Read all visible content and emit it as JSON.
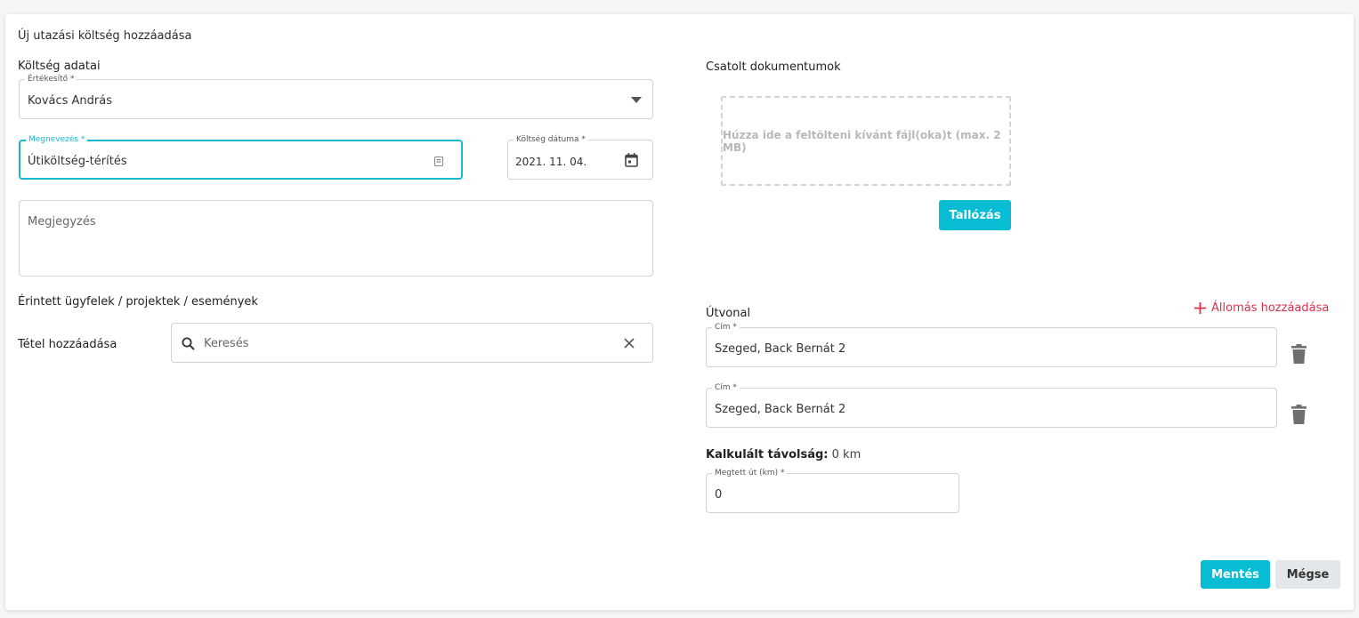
{
  "dialog": {
    "title": "Új utazási költség hozzáadása"
  },
  "expense": {
    "section_title": "Költség adatai",
    "salesperson": {
      "label": "Értékesítő *",
      "value": "Kovács András"
    },
    "name": {
      "label": "Megnevezés *",
      "value": "Útiköltség-térítés"
    },
    "date": {
      "label": "Költség dátuma *",
      "value": "2021. 11. 04."
    },
    "note": {
      "placeholder": "Megjegyzés"
    }
  },
  "related": {
    "section_title": "Érintett ügyfelek / projektek / események",
    "add_item_label": "Tétel hozzáadása",
    "search_placeholder": "Keresés"
  },
  "attachments": {
    "section_title": "Csatolt dokumentumok",
    "dropzone_text": "Húzza ide a feltölteni kívánt fájl(oka)t (max. 2 MB)",
    "browse_label": "Tallózás"
  },
  "route": {
    "section_title": "Útvonal",
    "add_stop_label": "Állomás hozzáadása",
    "stops": [
      {
        "label": "Cím *",
        "value": "Szeged, Back Bernát 2"
      },
      {
        "label": "Cím *",
        "value": "Szeged, Back Bernát 2"
      }
    ],
    "calculated_label": "Kalkulált távolság:",
    "calculated_value": "0 km",
    "distance": {
      "label": "Megtett út (km) *",
      "value": "0"
    }
  },
  "actions": {
    "save_label": "Mentés",
    "cancel_label": "Mégse"
  },
  "colors": {
    "accent": "#08bcd4",
    "add_link": "#d6334b",
    "focus": "#19b8cf"
  }
}
